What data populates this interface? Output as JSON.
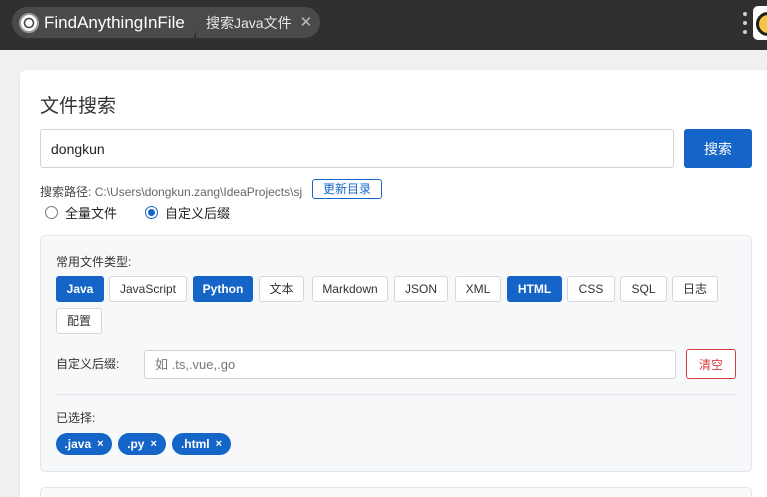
{
  "titlebar": {
    "app_name": "FindAnythingInFile",
    "tab_label": "搜索Java文件",
    "tab_close": "✕"
  },
  "main": {
    "title": "文件搜索",
    "search_value": "dongkun",
    "search_button": "搜索",
    "path_label": "搜索路径:",
    "path_value": "C:\\Users\\dongkun.zang\\IdeaProjects\\sj",
    "refresh_button": "更新目录",
    "radio_all": "全量文件",
    "radio_custom": "自定义后缀",
    "selected_mode": "自定义后缀"
  },
  "filter": {
    "common_label": "常用文件类型:",
    "types": [
      {
        "label": "Java",
        "active": true
      },
      {
        "label": "JavaScript",
        "active": false
      },
      {
        "label": "Python",
        "active": true
      },
      {
        "label": "文本",
        "active": false
      },
      {
        "label": "Markdown",
        "active": false
      },
      {
        "label": "JSON",
        "active": false
      },
      {
        "label": "XML",
        "active": false
      },
      {
        "label": "HTML",
        "active": true
      },
      {
        "label": "CSS",
        "active": false
      },
      {
        "label": "SQL",
        "active": false
      },
      {
        "label": "日志",
        "active": false
      },
      {
        "label": "配置",
        "active": false
      }
    ],
    "custom_label": "自定义后缀:",
    "custom_placeholder": "如 .ts,.vue,.go",
    "clear_button": "清空",
    "selected_label": "已选择:",
    "selected": [
      ".java",
      ".py",
      ".html"
    ],
    "chip_remove": "×"
  },
  "colors": {
    "accent": "#1565c8",
    "danger": "#d93c3c",
    "titlebar": "#303030"
  }
}
